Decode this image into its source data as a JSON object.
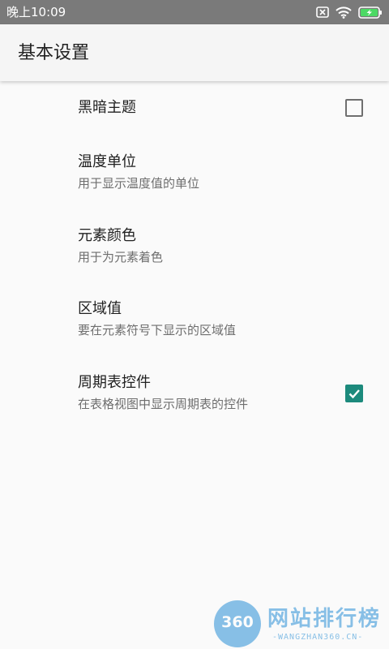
{
  "status_bar": {
    "time": "晚上10:09",
    "icons": [
      "sim-blocked-icon",
      "wifi-icon",
      "battery-charging-icon"
    ],
    "battery_color": "#4cd964"
  },
  "toolbar": {
    "title": "基本设置"
  },
  "preferences": [
    {
      "title": "黑暗主题",
      "summary": "",
      "checkbox": "unchecked"
    },
    {
      "title": "温度单位",
      "summary": "用于显示温度值的单位",
      "checkbox": "none"
    },
    {
      "title": "元素颜色",
      "summary": "用于为元素着色",
      "checkbox": "none"
    },
    {
      "title": "区域值",
      "summary": "要在元素符号下显示的区域值",
      "checkbox": "none"
    },
    {
      "title": "周期表控件",
      "summary": "在表格视图中显示周期表的控件",
      "checkbox": "checked"
    }
  ],
  "accent_color": "#1c8a7c",
  "watermark": {
    "badge": "360",
    "brand": "网站排行榜",
    "sub": "-WANGZHAN360.CN-"
  }
}
